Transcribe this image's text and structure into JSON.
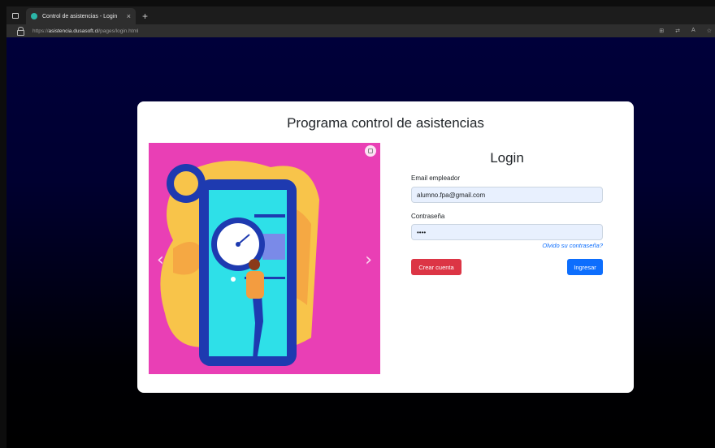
{
  "browser": {
    "tab_title": "Control de asistencias - Login",
    "close_glyph": "×",
    "new_tab_glyph": "+",
    "url_prefix": "https://",
    "url_host": "asistencia.dusasoft.cl",
    "url_path": "/pages/login.html",
    "icons": [
      "window-menu-icon",
      "lock-icon",
      "reader-view-icon",
      "translate-icon",
      "read-aloud-icon",
      "favorite-icon"
    ],
    "icon_glyphs": {
      "reader": "⊞",
      "translate": "⇄",
      "read_aloud": "A",
      "favorite": "☆"
    }
  },
  "page": {
    "title": "Programa control de asistencias",
    "carousel": {
      "prev_glyph": "‹",
      "next_glyph": "›"
    },
    "login": {
      "heading": "Login",
      "email_label": "Email empleador",
      "email_value": "alumno.fpa@gmail.com",
      "password_label": "Contraseña",
      "password_value": "••••",
      "forgot_link": "Olvido su contraseña?",
      "create_button": "Crear cuenta",
      "login_button": "Ingresar"
    }
  },
  "colors": {
    "background_top": "#00003a",
    "carousel_bg": "#e93fb5",
    "create_button": "#dc3545",
    "login_button": "#0d6efd",
    "input_bg": "#e8f0fe"
  }
}
